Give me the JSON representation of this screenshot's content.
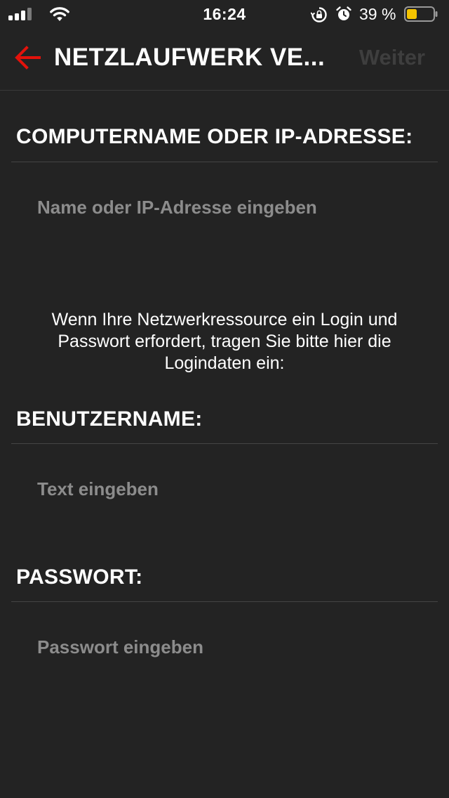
{
  "status_bar": {
    "time": "16:24",
    "battery_percent": "39 %",
    "battery_level": 0.39,
    "battery_color": "#f5c400",
    "icons": [
      "signal-icon",
      "wifi-icon",
      "rotation-lock-icon",
      "alarm-icon",
      "battery-icon"
    ]
  },
  "nav": {
    "title": "NETZLAUFWERK VE...",
    "next_label": "Weiter",
    "back_icon": "arrow-left-icon",
    "accent_color": "#e3120b"
  },
  "form": {
    "computer_label": "COMPUTERNAME ODER IP-ADRESSE:",
    "computer_placeholder": "Name oder IP-Adresse eingeben",
    "info_text": "Wenn Ihre Netzwerkressource ein Login und Passwort erfordert, tragen Sie bitte hier die Logindaten ein:",
    "username_label": "BENUTZERNAME:",
    "username_placeholder": "Text eingeben",
    "password_label": "PASSWORT:",
    "password_placeholder": "Passwort eingeben"
  }
}
